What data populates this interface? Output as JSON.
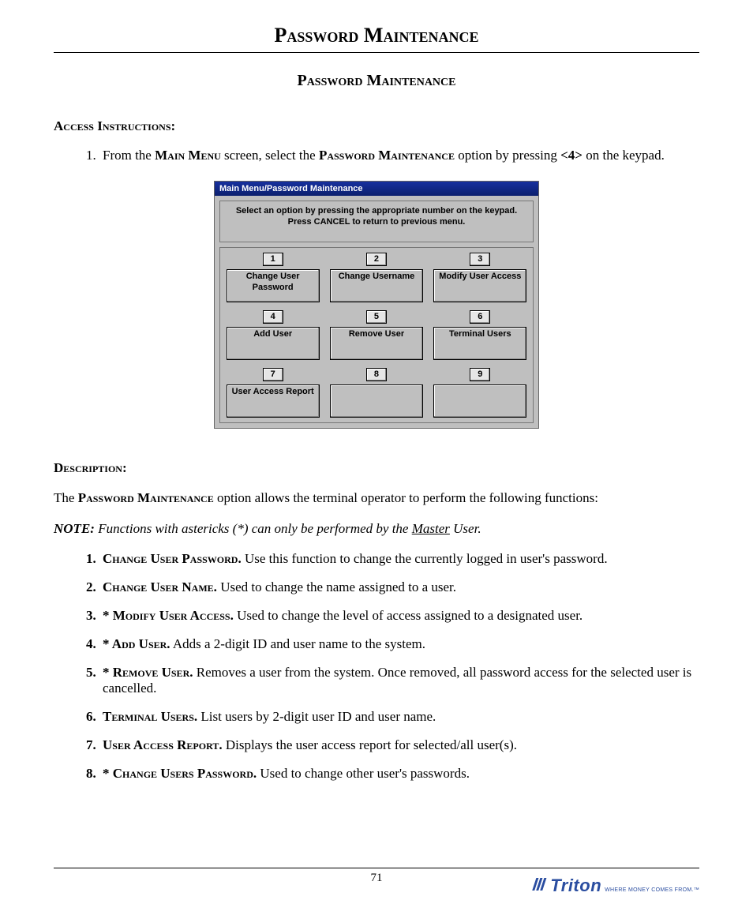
{
  "page": {
    "top_title": "Password Maintenance",
    "section_title": "Password Maintenance",
    "access_heading": "Access Instructions:",
    "access_step": {
      "pre": "From the ",
      "sc1": "Main Menu",
      "mid1": " screen, select the ",
      "sc2": "Password Maintenance",
      "mid2": " option by pressing ",
      "key": "<4>",
      "post": " on the keypad."
    },
    "description_heading": "Description:",
    "description_line": {
      "pre": "The ",
      "sc": "Password Maintenance",
      "post": " option allows the terminal operator to perform the following functions:"
    },
    "note": {
      "label": "NOTE:",
      "body_pre": " Functions with astericks (*) can only be performed by the ",
      "master": "Master",
      "body_post": " User."
    },
    "desc_items": [
      {
        "title": "Change User Password.",
        "body": "  Use this function to change the currently logged in user's password."
      },
      {
        "title": "Change User Name.",
        "body": "  Used to change the name assigned to a user."
      },
      {
        "title": "* Modify User Access.",
        "body": "  Used to change the level of access assigned to a designated user."
      },
      {
        "title": "* Add User.",
        "body": "  Adds a 2-digit ID and user name to the system."
      },
      {
        "title": "* Remove User.",
        "body": "  Removes a user from the system. Once removed, all password access for the selected user is cancelled."
      },
      {
        "title": "Terminal Users.",
        "body": "  List users by 2-digit user ID and user name."
      },
      {
        "title": "User Access Report.",
        "body": "  Displays the user access report for selected/all user(s)."
      },
      {
        "title": "* Change Users Password.",
        "body": "  Used to change other user's passwords."
      }
    ],
    "page_number": "71"
  },
  "screenshot": {
    "titlebar": "Main Menu/Password Maintenance",
    "instruction_l1": "Select an option by pressing the appropriate number on the keypad.",
    "instruction_l2": "Press CANCEL to return to previous menu.",
    "cells": [
      {
        "num": "1",
        "label": "Change User Password"
      },
      {
        "num": "2",
        "label": "Change Username"
      },
      {
        "num": "3",
        "label": "Modify User Access"
      },
      {
        "num": "4",
        "label": "Add User"
      },
      {
        "num": "5",
        "label": "Remove User"
      },
      {
        "num": "6",
        "label": "Terminal Users"
      },
      {
        "num": "7",
        "label": "User Access Report"
      },
      {
        "num": "8",
        "label": ""
      },
      {
        "num": "9",
        "label": ""
      }
    ]
  },
  "brand": {
    "name": "Triton",
    "tagline": "WHERE MONEY COMES FROM.™"
  }
}
